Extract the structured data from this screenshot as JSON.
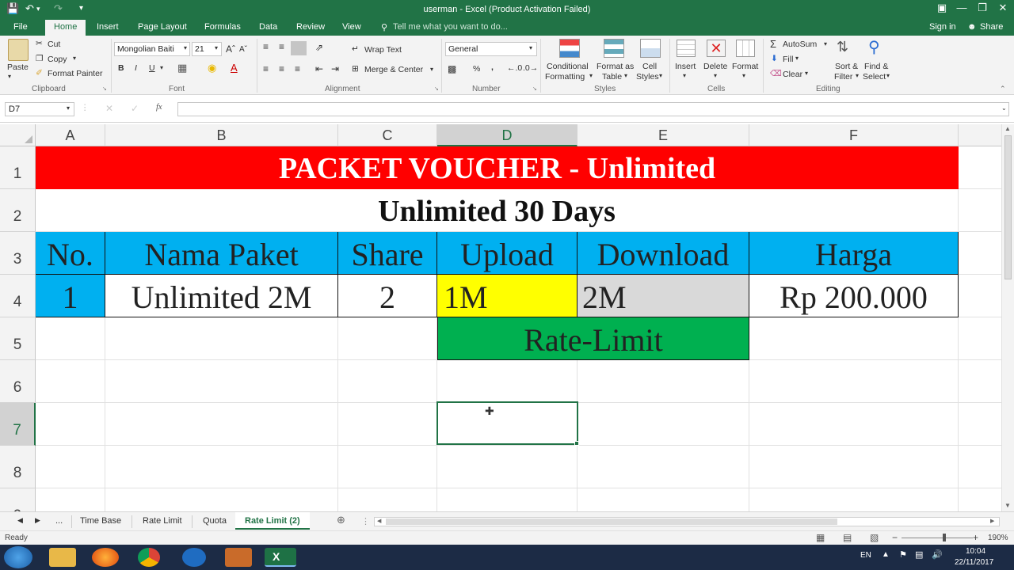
{
  "window": {
    "title": "userman - Excel (Product Activation Failed)"
  },
  "menu_tabs": [
    "File",
    "Home",
    "Insert",
    "Page Layout",
    "Formulas",
    "Data",
    "Review",
    "View"
  ],
  "tell_me": "Tell me what you want to do...",
  "account": {
    "sign_in": "Sign in",
    "share": "Share"
  },
  "ribbon": {
    "clipboard": {
      "paste": "Paste",
      "cut": "Cut",
      "copy": "Copy",
      "format_painter": "Format Painter",
      "group": "Clipboard"
    },
    "font": {
      "family": "Mongolian Baiti",
      "size": "21",
      "bold": "B",
      "italic": "I",
      "underline": "U",
      "group": "Font"
    },
    "alignment": {
      "wrap_text": "Wrap Text",
      "merge_center": "Merge & Center",
      "group": "Alignment"
    },
    "number": {
      "format": "General",
      "percent": "%",
      "comma": ",",
      "group": "Number"
    },
    "styles": {
      "conditional_1": "Conditional",
      "conditional_2": "Formatting",
      "format_as_1": "Format as",
      "format_as_2": "Table",
      "cell_styles_1": "Cell",
      "cell_styles_2": "Styles",
      "group": "Styles"
    },
    "cells": {
      "insert": "Insert",
      "delete": "Delete",
      "format": "Format",
      "group": "Cells"
    },
    "editing": {
      "autosum": "AutoSum",
      "fill": "Fill",
      "clear": "Clear",
      "sort_1": "Sort &",
      "sort_2": "Filter",
      "find_1": "Find &",
      "find_2": "Select",
      "group": "Editing"
    }
  },
  "formula_bar": {
    "name_box": "D7",
    "fx": "fx",
    "value": ""
  },
  "columns": [
    "A",
    "B",
    "C",
    "D",
    "E",
    "F"
  ],
  "rows": [
    "1",
    "2",
    "3",
    "4",
    "5",
    "6",
    "7",
    "8",
    "9"
  ],
  "sheet": {
    "title": "PACKET VOUCHER - Unlimited",
    "subtitle": "Unlimited 30 Days",
    "headers": [
      "No.",
      "Nama Paket",
      "Share",
      "Upload",
      "Download",
      "Harga"
    ],
    "row4": [
      "1",
      "Unlimited 2M",
      "2",
      "1M",
      "2M",
      "Rp 200.000"
    ],
    "rate_limit": "Rate-Limit"
  },
  "sheet_tabs": [
    "...",
    "Time Base",
    "Rate Limit",
    "Quota",
    "Rate Limit (2)"
  ],
  "active_sheet": "Rate Limit (2)",
  "status": {
    "ready": "Ready",
    "zoom": "190%"
  },
  "taskbar": {
    "lang": "EN",
    "time": "10:04",
    "date": "22/11/2017"
  },
  "colors": {
    "excel_green": "#217346",
    "title_red": "#ff0000",
    "header_blue": "#00b0f0",
    "upload_yellow": "#ffff00",
    "download_grey": "#d9d9d9",
    "rate_green": "#00b050"
  }
}
